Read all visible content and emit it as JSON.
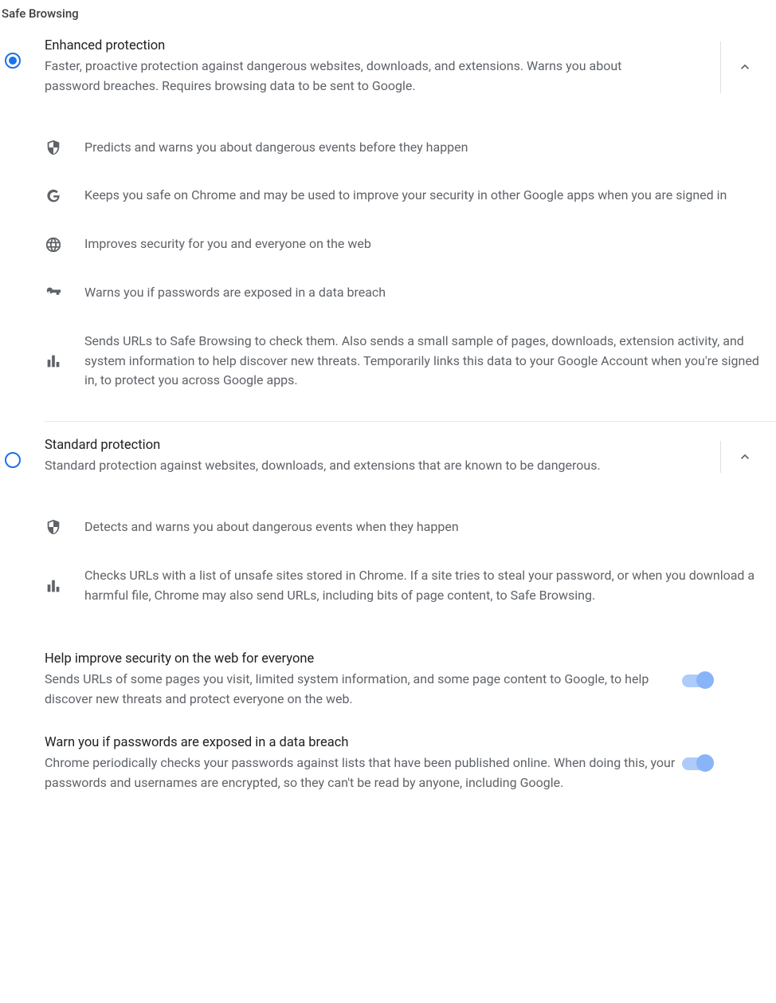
{
  "section_title": "Safe Browsing",
  "enhanced": {
    "title": "Enhanced protection",
    "desc": "Faster, proactive protection against dangerous websites, downloads, and extensions. Warns you about password breaches. Requires browsing data to be sent to Google.",
    "selected": true,
    "expanded": true,
    "details": [
      "Predicts and warns you about dangerous events before they happen",
      "Keeps you safe on Chrome and may be used to improve your security in other Google apps when you are signed in",
      "Improves security for you and everyone on the web",
      "Warns you if passwords are exposed in a data breach",
      "Sends URLs to Safe Browsing to check them. Also sends a small sample of pages, downloads, extension activity, and system information to help discover new threats. Temporarily links this data to your Google Account when you're signed in, to protect you across Google apps."
    ]
  },
  "standard": {
    "title": "Standard protection",
    "desc": "Standard protection against websites, downloads, and extensions that are known to be dangerous.",
    "selected": false,
    "expanded": true,
    "details": [
      "Detects and warns you about dangerous events when they happen",
      "Checks URLs with a list of unsafe sites stored in Chrome. If a site tries to steal your password, or when you download a harmful file, Chrome may also send URLs, including bits of page content, to Safe Browsing."
    ],
    "sub": [
      {
        "title": "Help improve security on the web for everyone",
        "desc": "Sends URLs of some pages you visit, limited system information, and some page content to Google, to help discover new threats and protect everyone on the web.",
        "on": true
      },
      {
        "title": "Warn you if passwords are exposed in a data breach",
        "desc": "Chrome periodically checks your passwords against lists that have been published online. When doing this, your passwords and usernames are encrypted, so they can't be read by anyone, including Google.",
        "on": true
      }
    ]
  }
}
